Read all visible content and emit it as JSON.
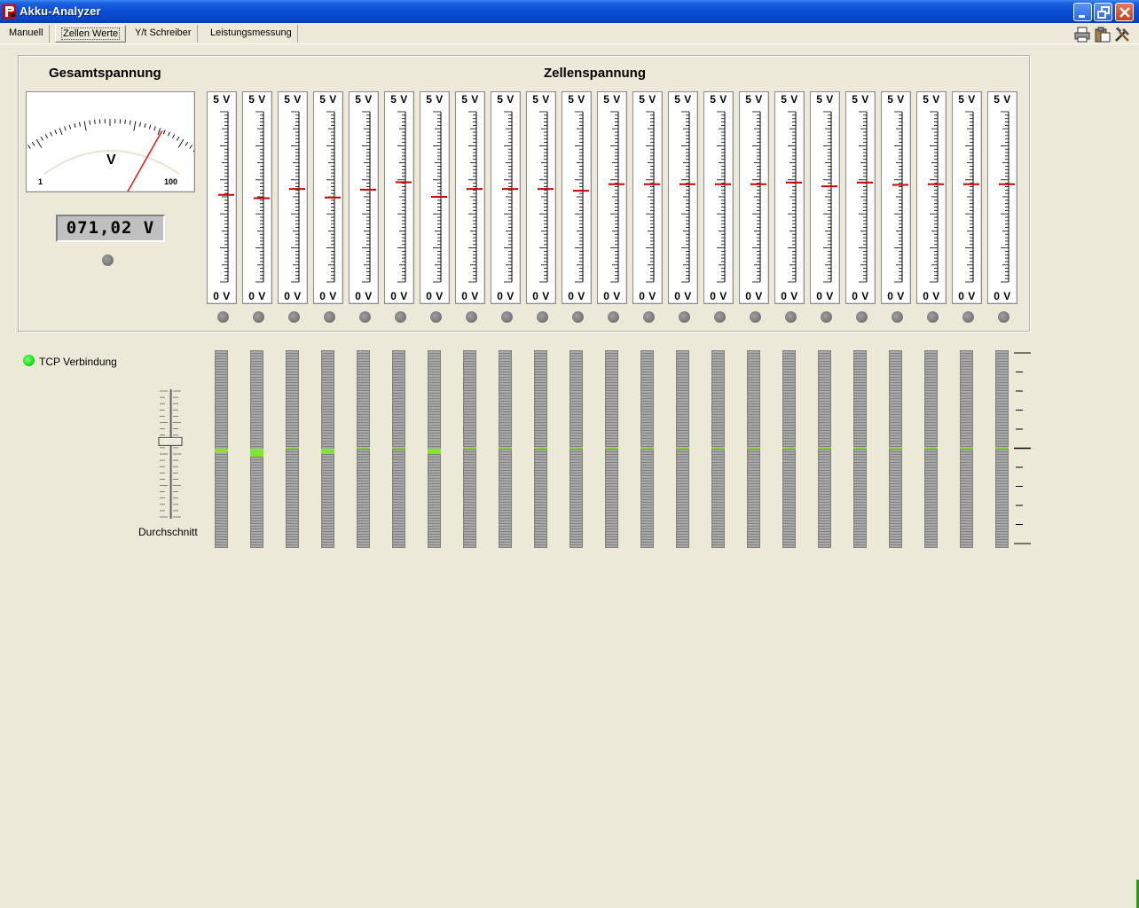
{
  "window": {
    "title": "Akku-Analyzer"
  },
  "tabs": [
    {
      "label": "Manuell",
      "active": false
    },
    {
      "label": "Zellen Werte",
      "active": true
    },
    {
      "label": "Y/t Schreiber",
      "active": false
    },
    {
      "label": "Leistungsmessung",
      "active": false
    }
  ],
  "toolbar_icons": [
    "printer-icon",
    "clipboard-icon",
    "tools-icon"
  ],
  "total": {
    "heading": "Gesamtspannung",
    "meter_unit": "V",
    "meter_min_label": "1",
    "meter_max_label": "100",
    "meter_needle_fraction": 0.71,
    "lcd_value": "071,02 V"
  },
  "cells": {
    "heading": "Zellenspannung",
    "top_label": "5 V",
    "bottom_label": "0 V",
    "values": [
      2.56,
      2.46,
      2.73,
      2.48,
      2.71,
      2.93,
      2.5,
      2.73,
      2.73,
      2.73,
      2.68,
      2.87,
      2.87,
      2.87,
      2.87,
      2.87,
      2.92,
      2.81,
      2.92,
      2.85,
      2.87,
      2.87,
      2.87
    ],
    "deviation_pct": [
      -7,
      -15,
      0,
      -10,
      0,
      2,
      -10,
      0,
      0,
      0,
      0,
      2,
      2,
      2,
      2,
      2,
      2,
      0,
      2,
      2,
      2,
      2,
      2
    ],
    "colors": {
      "marker": "#cc0000",
      "deviation": "#84e62a",
      "led_on": "#16e016",
      "led_off": "#7a7a7a"
    }
  },
  "status": {
    "tcp_label": "TCP Verbindung",
    "tcp_connected": true
  },
  "average_slider": {
    "label": "Durchschnitt",
    "position_fraction": 0.6
  }
}
